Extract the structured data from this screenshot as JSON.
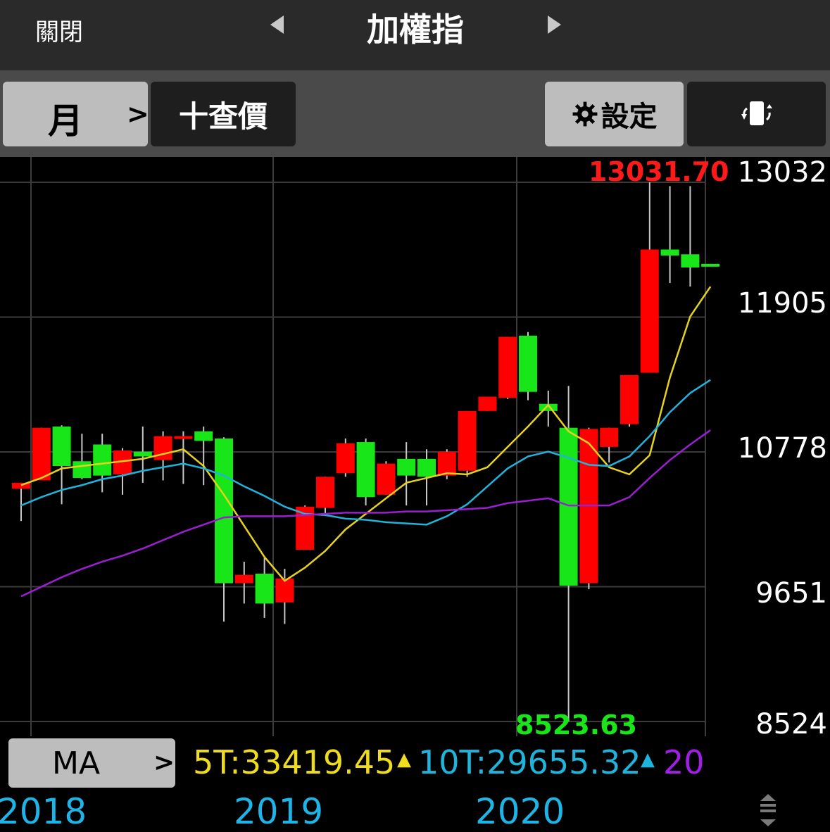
{
  "header": {
    "close_label": "關閉",
    "title": "加權指",
    "prev_icon": "triangle-left-icon",
    "next_icon": "triangle-right-icon"
  },
  "toolbar": {
    "period_label": "月",
    "period_chevron": ">",
    "crosshair_label": "十查價",
    "settings_label": "設定",
    "settings_icon": "gear-icon",
    "rotate_icon": "rotate-device-icon"
  },
  "indicator": {
    "ma_label": "MA",
    "ma_chevron": ">",
    "ma5_text": "5T:33419.45",
    "ma10_text": "10T:29655.32",
    "ma20_text": "20"
  },
  "colors": {
    "up": "#ff0000",
    "down": "#19e619",
    "ma5": "#e6d21e",
    "ma10": "#1eb4dc",
    "ma20": "#9b1ed2",
    "grid": "#3c3c3c",
    "year": "#1eb4e6"
  },
  "chart_data": {
    "type": "candlestick",
    "title": "加權指",
    "period": "月",
    "ylim": [
      8524,
      13032
    ],
    "y_ticks": [
      "13032",
      "11905",
      "10778",
      "9651",
      "8524"
    ],
    "x_labels": [
      "2018",
      "2019",
      "2020"
    ],
    "max_label": "13031.70",
    "min_label": "8523.63",
    "candles": [
      {
        "o": 10470,
        "h": 10470,
        "l": 10200,
        "c": 10520
      },
      {
        "o": 10540,
        "h": 10690,
        "l": 10550,
        "c": 10980
      },
      {
        "o": 10990,
        "h": 11000,
        "l": 10340,
        "c": 10660
      },
      {
        "o": 10700,
        "h": 10930,
        "l": 10550,
        "c": 10560
      },
      {
        "o": 10840,
        "h": 10930,
        "l": 10440,
        "c": 10580
      },
      {
        "o": 10590,
        "h": 10810,
        "l": 10420,
        "c": 10790
      },
      {
        "o": 10780,
        "h": 10990,
        "l": 10520,
        "c": 10740
      },
      {
        "o": 10710,
        "h": 10950,
        "l": 10540,
        "c": 10910
      },
      {
        "o": 10910,
        "h": 10950,
        "l": 10510,
        "c": 10910
      },
      {
        "o": 10950,
        "h": 10990,
        "l": 10500,
        "c": 10870
      },
      {
        "o": 10890,
        "h": 10900,
        "l": 9360,
        "c": 9680
      },
      {
        "o": 9680,
        "h": 9860,
        "l": 9510,
        "c": 9750
      },
      {
        "o": 9760,
        "h": 9890,
        "l": 9390,
        "c": 9510
      },
      {
        "o": 9520,
        "h": 9800,
        "l": 9340,
        "c": 9720
      },
      {
        "o": 9960,
        "h": 10330,
        "l": 9970,
        "c": 10320
      },
      {
        "o": 10310,
        "h": 10380,
        "l": 10260,
        "c": 10570
      },
      {
        "o": 10600,
        "h": 10890,
        "l": 10570,
        "c": 10850
      },
      {
        "o": 10860,
        "h": 10890,
        "l": 10330,
        "c": 10400
      },
      {
        "o": 10420,
        "h": 10700,
        "l": 10450,
        "c": 10680
      },
      {
        "o": 10720,
        "h": 10860,
        "l": 10330,
        "c": 10580
      },
      {
        "o": 10720,
        "h": 10800,
        "l": 10330,
        "c": 10570
      },
      {
        "o": 10580,
        "h": 10800,
        "l": 10550,
        "c": 10780
      },
      {
        "o": 10620,
        "h": 10890,
        "l": 10570,
        "c": 11120
      },
      {
        "o": 11120,
        "h": 11240,
        "l": 11120,
        "c": 11240
      },
      {
        "o": 11230,
        "h": 11550,
        "l": 11220,
        "c": 11740
      },
      {
        "o": 11750,
        "h": 11780,
        "l": 11210,
        "c": 11280
      },
      {
        "o": 11180,
        "h": 11290,
        "l": 10990,
        "c": 11120
      },
      {
        "o": 10980,
        "h": 11330,
        "l": 8524,
        "c": 9660
      },
      {
        "o": 9680,
        "h": 10980,
        "l": 9630,
        "c": 10970
      },
      {
        "o": 10820,
        "h": 10970,
        "l": 10690,
        "c": 10980
      },
      {
        "o": 11010,
        "h": 11420,
        "l": 10990,
        "c": 11420
      },
      {
        "o": 11440,
        "h": 13032,
        "l": 11440,
        "c": 12470
      },
      {
        "o": 12470,
        "h": 13000,
        "l": 12190,
        "c": 12420
      },
      {
        "o": 12430,
        "h": 13000,
        "l": 12160,
        "c": 12320
      },
      {
        "o": 12350,
        "h": 12350,
        "l": 12330,
        "c": 12330
      }
    ],
    "series": [
      {
        "name": "5T",
        "values": [
          10500,
          10560,
          10640,
          10660,
          10680,
          10700,
          10720,
          10760,
          10800,
          10660,
          10420,
          10160,
          9900,
          9700,
          9810,
          9950,
          10130,
          10260,
          10390,
          10520,
          10560,
          10600,
          10590,
          10650,
          10820,
          10990,
          11170,
          10950,
          10850,
          10650,
          10590,
          10750,
          11400,
          11910,
          12160
        ]
      },
      {
        "name": "10T",
        "values": [
          10330,
          10400,
          10460,
          10500,
          10550,
          10580,
          10620,
          10650,
          10680,
          10640,
          10580,
          10490,
          10410,
          10320,
          10260,
          10250,
          10220,
          10210,
          10190,
          10180,
          10170,
          10240,
          10340,
          10490,
          10640,
          10740,
          10780,
          10730,
          10670,
          10660,
          10740,
          10910,
          11110,
          11270,
          11380
        ]
      },
      {
        "name": "20T",
        "values": [
          9570,
          9650,
          9730,
          9800,
          9860,
          9910,
          9970,
          10040,
          10110,
          10170,
          10230,
          10240,
          10240,
          10240,
          10250,
          10260,
          10270,
          10270,
          10270,
          10280,
          10280,
          10290,
          10300,
          10310,
          10350,
          10370,
          10390,
          10330,
          10330,
          10330,
          10400,
          10560,
          10710,
          10840,
          10960
        ]
      }
    ]
  }
}
